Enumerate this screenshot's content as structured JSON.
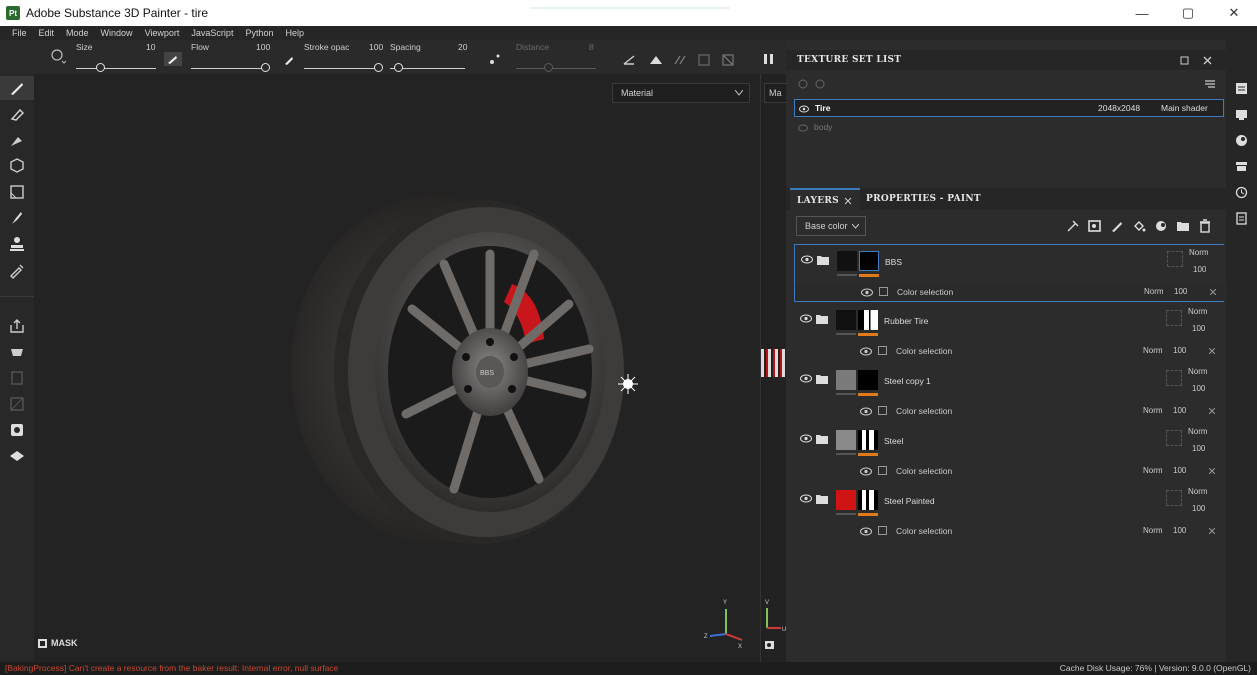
{
  "window": {
    "title": "Adobe Substance 3D Painter - tire",
    "app_icon_label": "Pt",
    "minimize": "—",
    "maximize": "▢",
    "close": "✕"
  },
  "menu": [
    "File",
    "Edit",
    "Mode",
    "Window",
    "Viewport",
    "JavaScript",
    "Python",
    "Help"
  ],
  "toolbar": {
    "size_label": "Size",
    "size_value": "10",
    "flow_label": "Flow",
    "flow_value": "100",
    "stroke_label": "Stroke opac",
    "stroke_value": "100",
    "spacing_label": "Spacing",
    "spacing_value": "20",
    "distance_label": "Distance",
    "distance_value": "8"
  },
  "viewport": {
    "mode_select": "Material",
    "second_select": "Ma",
    "mask_label": "MASK",
    "axis_y": "Y",
    "axis_z": "Z",
    "axis_x": "X",
    "axis_v": "V",
    "axis_u": "U",
    "hub_text": "BBS"
  },
  "texture_set_list": {
    "header": "TEXTURE SET LIST",
    "rows": [
      {
        "name": "Tire",
        "resolution": "2048x2048",
        "shader": "Main shader",
        "selected": true
      },
      {
        "name": "body",
        "resolution": "",
        "shader": "",
        "selected": false
      }
    ]
  },
  "layers_panel": {
    "tab_layers": "LAYERS",
    "tab_properties": "PROPERTIES - PAINT",
    "channel_select": "Base color",
    "layers": [
      {
        "name": "BBS",
        "blend": "Norm",
        "opacity": "100",
        "sub": "Color selection",
        "sub_blend": "Norm",
        "sub_opacity": "100",
        "selected": true,
        "fill_color": "#111111"
      },
      {
        "name": "Rubber Tire",
        "blend": "Norm",
        "opacity": "100",
        "sub": "Color selection",
        "sub_blend": "Norm",
        "sub_opacity": "100",
        "selected": false,
        "fill_color": "#111111"
      },
      {
        "name": "Steel copy 1",
        "blend": "Norm",
        "opacity": "100",
        "sub": "Color selection",
        "sub_blend": "Norm",
        "sub_opacity": "100",
        "selected": false,
        "fill_color": "#7a7a7a"
      },
      {
        "name": "Steel",
        "blend": "Norm",
        "opacity": "100",
        "sub": "Color selection",
        "sub_blend": "Norm",
        "sub_opacity": "100",
        "selected": false,
        "fill_color": "#8a8a8a"
      },
      {
        "name": "Steel Painted",
        "blend": "Norm",
        "opacity": "100",
        "sub": "Color selection",
        "sub_blend": "Norm",
        "sub_opacity": "100",
        "selected": false,
        "fill_color": "#d01313"
      }
    ]
  },
  "status": {
    "error": "[BakingProcess] Can't create a resource from the baker result: Internal error, null surface",
    "info": "Cache Disk Usage:  76% | Version: 9.0.0 (OpenGL)"
  },
  "colors": {
    "accent_blue": "#3d7bbf",
    "orange": "#e07a1a",
    "error_red": "#c7472f"
  }
}
